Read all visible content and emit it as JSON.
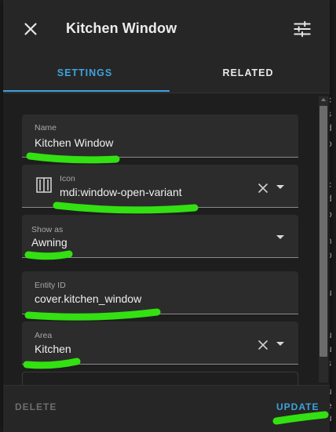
{
  "dialog": {
    "title": "Kitchen Window",
    "close_icon": "close-icon",
    "settings_icon": "tune-icon"
  },
  "tabs": [
    {
      "label": "SETTINGS",
      "active": true
    },
    {
      "label": "RELATED",
      "active": false
    }
  ],
  "fields": {
    "name": {
      "label": "Name",
      "value": "Kitchen Window"
    },
    "icon": {
      "label": "Icon",
      "value": "mdi:window-open-variant",
      "icon": "window-open-variant-icon"
    },
    "show_as": {
      "label": "Show as",
      "value": "Awning"
    },
    "entity_id": {
      "label": "Entity ID",
      "value": "cover.kitchen_window"
    },
    "area": {
      "label": "Area",
      "value": "Kitchen"
    }
  },
  "footer": {
    "delete_label": "DELETE",
    "update_label": "UPDATE"
  },
  "colors": {
    "accent": "#3ea3dc",
    "annotation": "#33e012",
    "surface": "#1e1e1e"
  }
}
